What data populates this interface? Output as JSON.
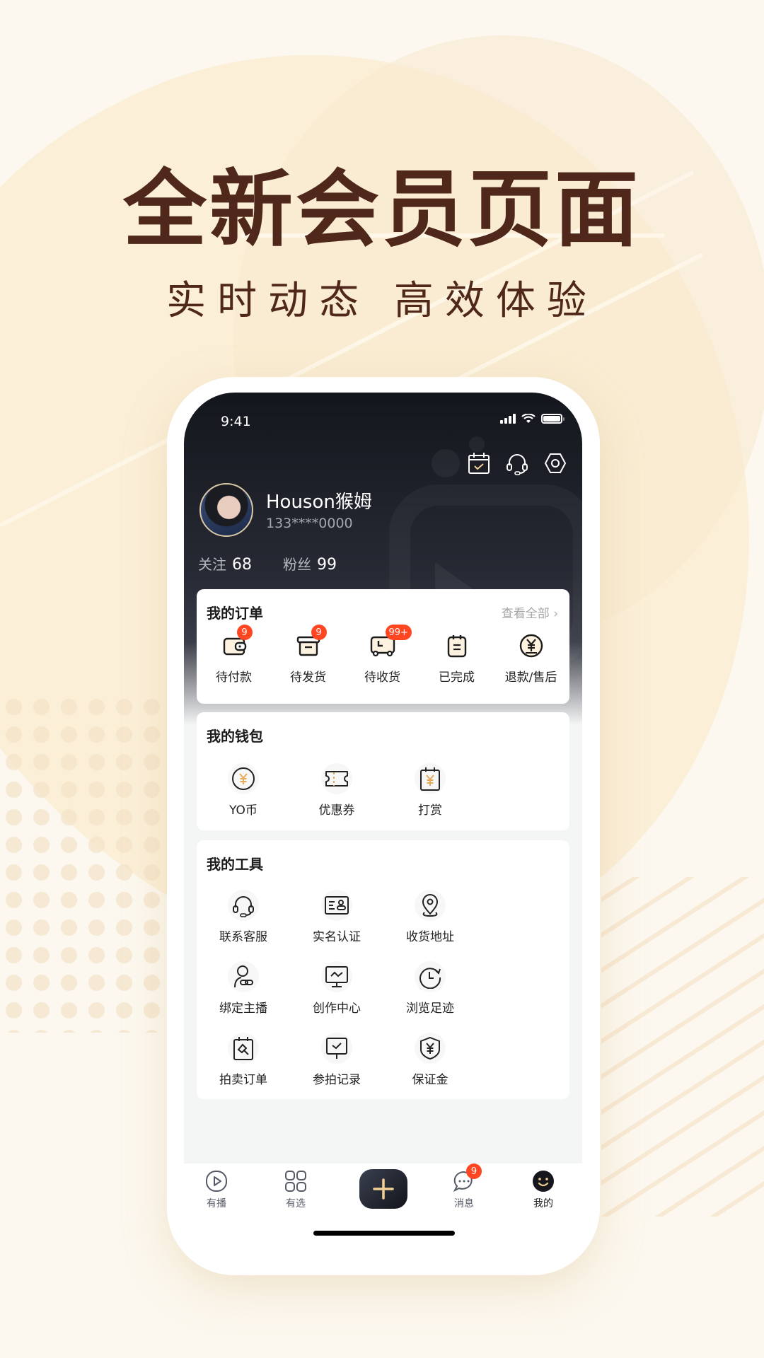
{
  "promo": {
    "headline": "全新会员页面",
    "subheadline": "实时动态 高效体验"
  },
  "status_bar": {
    "time": "9:41"
  },
  "header": {
    "icons": [
      "calendar-check-icon",
      "headset-icon",
      "settings-hex-icon"
    ],
    "user": {
      "name": "Houson猴姆",
      "phone": "133****0000"
    },
    "stats": [
      {
        "label": "关注",
        "value": "68"
      },
      {
        "label": "粉丝",
        "value": "99"
      }
    ]
  },
  "orders": {
    "title": "我的订单",
    "view_all": "查看全部",
    "items": [
      {
        "label": "待付款",
        "icon": "wallet-icon",
        "badge": "9"
      },
      {
        "label": "待发货",
        "icon": "box-icon",
        "badge": "9"
      },
      {
        "label": "待收货",
        "icon": "delivery-truck-icon",
        "badge": "99+"
      },
      {
        "label": "已完成",
        "icon": "clipboard-icon",
        "badge": ""
      },
      {
        "label": "退款/售后",
        "icon": "refund-yen-icon",
        "badge": ""
      }
    ]
  },
  "wallet": {
    "title": "我的钱包",
    "items": [
      {
        "label": "YO币",
        "icon": "coin-icon"
      },
      {
        "label": "优惠券",
        "icon": "coupon-icon"
      },
      {
        "label": "打赏",
        "icon": "reward-icon"
      }
    ]
  },
  "tools": {
    "title": "我的工具",
    "items": [
      {
        "label": "联系客服",
        "icon": "headset-icon"
      },
      {
        "label": "实名认证",
        "icon": "id-card-icon"
      },
      {
        "label": "收货地址",
        "icon": "location-pin-icon"
      },
      {
        "label": "绑定主播",
        "icon": "user-link-icon"
      },
      {
        "label": "创作中心",
        "icon": "monitor-chart-icon"
      },
      {
        "label": "浏览足迹",
        "icon": "history-clock-icon"
      },
      {
        "label": "拍卖订单",
        "icon": "auction-hammer-icon"
      },
      {
        "label": "参拍记录",
        "icon": "bid-record-icon"
      },
      {
        "label": "保证金",
        "icon": "shield-yen-icon"
      }
    ]
  },
  "tabbar": {
    "tabs": [
      {
        "label": "有播",
        "icon": "play-icon"
      },
      {
        "label": "有选",
        "icon": "grid-icon"
      },
      {
        "label": "",
        "icon": "plus-icon"
      },
      {
        "label": "消息",
        "icon": "chat-bubble-icon",
        "badge": "9"
      },
      {
        "label": "我的",
        "icon": "smiley-icon",
        "active": true
      }
    ]
  },
  "colors": {
    "brand_dark": "#1c1f27",
    "accent_gold": "#f2cf95",
    "badge_red": "#ff4622",
    "headline_brown": "#4f271b"
  }
}
